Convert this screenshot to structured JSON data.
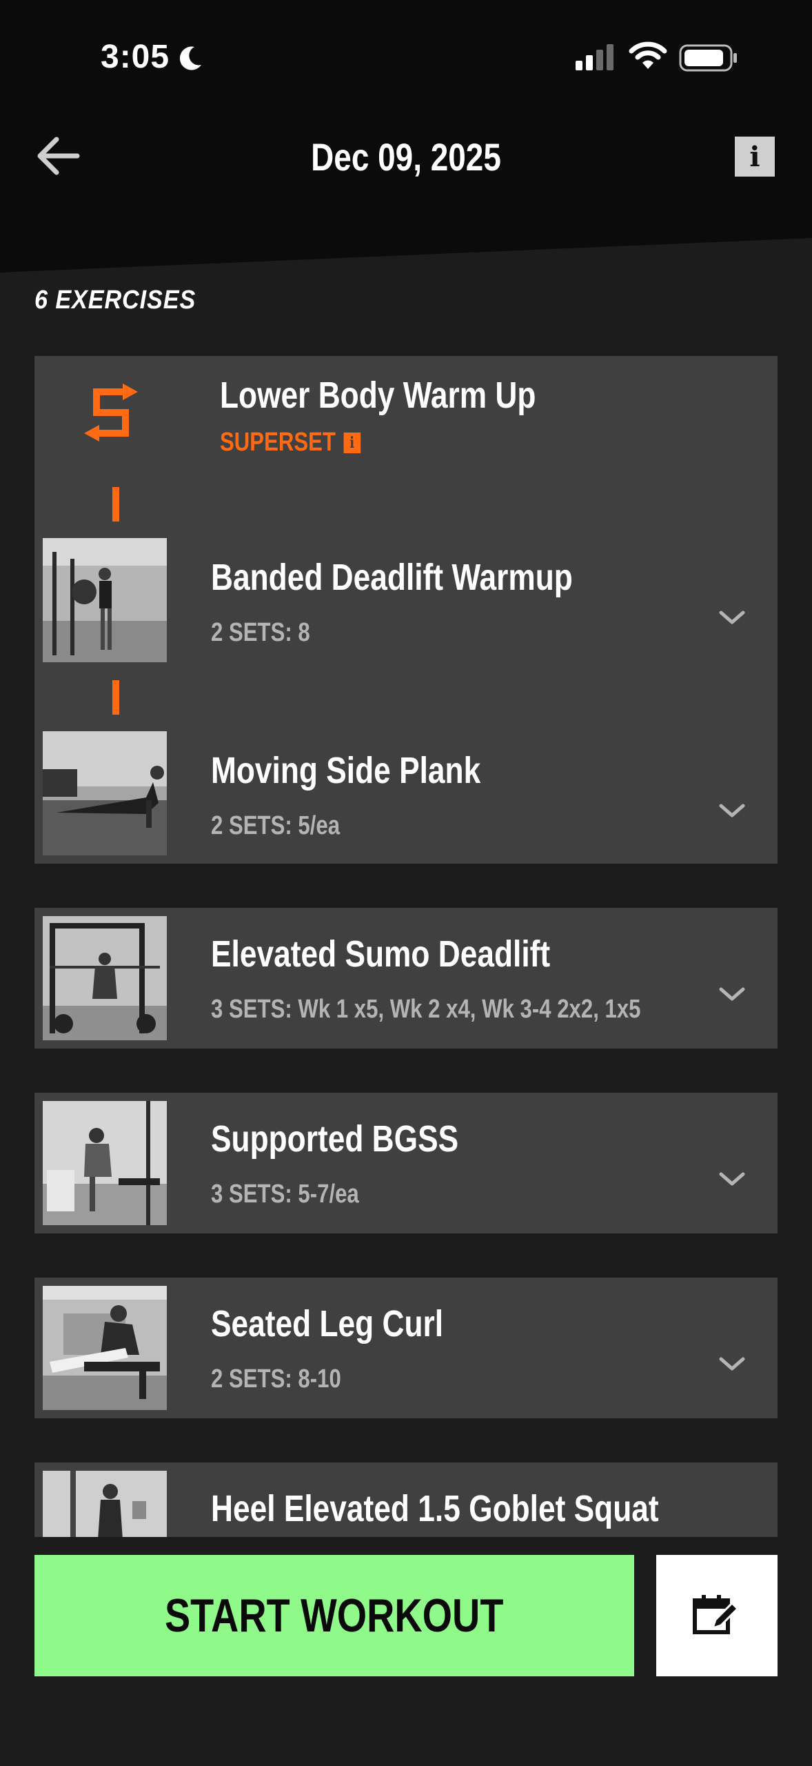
{
  "status_bar": {
    "time": "3:05"
  },
  "nav": {
    "title": "Dec 09, 2025"
  },
  "section": {
    "count_label": "6 EXERCISES"
  },
  "superset": {
    "title": "Lower Body Warm Up",
    "label": "SUPERSET",
    "exercises": [
      {
        "name": "Banded Deadlift Warmup",
        "sets": "2 SETS: 8"
      },
      {
        "name": "Moving Side Plank",
        "sets": "2 SETS: 5/ea"
      }
    ]
  },
  "exercises": [
    {
      "name": "Elevated Sumo Deadlift",
      "sets": "3 SETS: Wk 1 x5, Wk 2 x4, Wk 3-4 2x2, 1x5"
    },
    {
      "name": "Supported BGSS",
      "sets": "3 SETS: 5-7/ea"
    },
    {
      "name": "Seated Leg Curl",
      "sets": "2 SETS: 8-10"
    },
    {
      "name": "Heel Elevated 1.5 Goblet Squat",
      "sets": ""
    }
  ],
  "actions": {
    "start_label": "START WORKOUT"
  },
  "colors": {
    "accent": "#ff6a13",
    "start_button": "#8ff98a",
    "card": "#404040",
    "background": "#1c1c1c"
  },
  "icons": [
    "moon-icon",
    "signal-icon",
    "wifi-icon",
    "battery-icon",
    "back-arrow-icon",
    "info-icon",
    "superset-icon",
    "chevron-down-icon",
    "calendar-edit-icon"
  ]
}
